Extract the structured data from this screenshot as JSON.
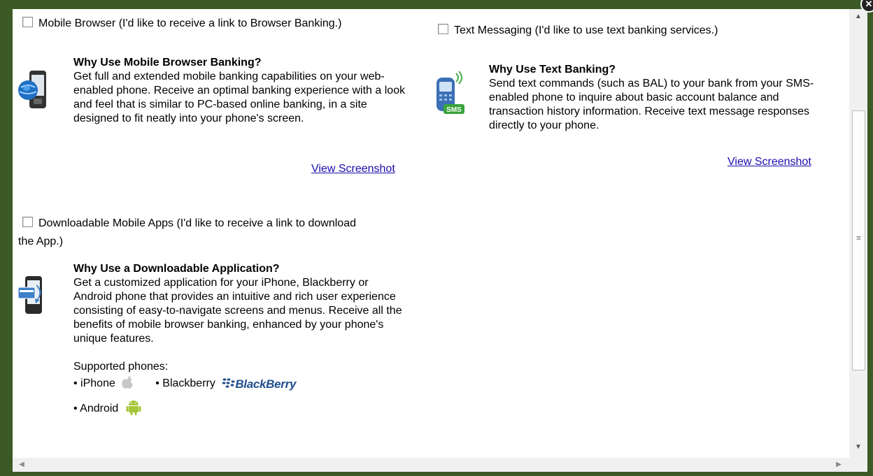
{
  "options": {
    "mobile_browser": {
      "label": "Mobile Browser (I'd like to receive a link to Browser Banking.)",
      "title": "Why Use Mobile Browser Banking?",
      "description": "Get full and extended mobile banking capabilities on your web-enabled phone. Receive an optimal banking experience with a look and feel that is similar to PC-based online banking, in a site designed to fit neatly into your phone's screen.",
      "link": "View Screenshot"
    },
    "text_messaging": {
      "label": "Text Messaging (I'd like to use text banking services.)",
      "title": "Why Use Text Banking?",
      "description": "Send text commands (such as BAL) to your bank from your SMS-enabled phone to inquire about basic account balance and transaction history information. Receive text message responses directly to your phone.",
      "link": "View Screenshot",
      "sms_badge": "SMS"
    },
    "mobile_apps": {
      "label_line1": "Downloadable Mobile Apps (I'd like to receive a link to download",
      "label_line2": "the App.)",
      "title": "Why Use a Downloadable Application?",
      "description": "Get a customized application for your iPhone, Blackberry or Android phone that provides an intuitive and rich user experience consisting of easy-to-navigate screens and menus. Receive all the benefits of mobile browser banking, enhanced by your phone's unique features.",
      "supported_label": "Supported phones:",
      "phones": {
        "iphone": "• iPhone",
        "blackberry": "• Blackberry",
        "blackberry_logo": "BlackBerry",
        "android": "• Android"
      }
    }
  },
  "colors": {
    "frame": "#3c5a26",
    "link": "#1a0dab",
    "android_green": "#a4c639",
    "blackberry_blue": "#1f4e8c"
  },
  "icons": {
    "close": "close-icon",
    "scroll_up": "▲",
    "scroll_down": "▼",
    "scroll_left": "◀",
    "scroll_right": "▶",
    "grip": "≡"
  }
}
